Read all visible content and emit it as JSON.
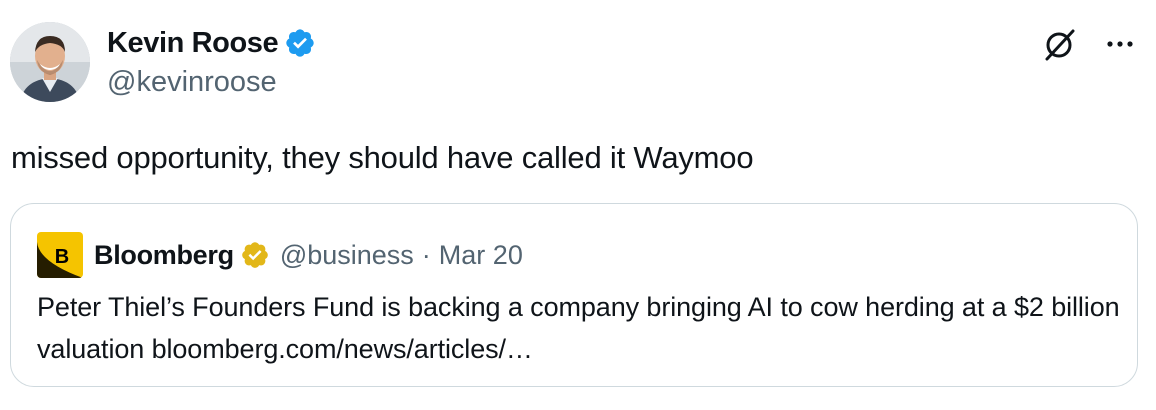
{
  "tweet": {
    "author": {
      "display_name": "Kevin Roose",
      "handle": "@kevinroose",
      "verified": true,
      "badge_color": "#1d9bf0"
    },
    "text": "missed opportunity, they should have called it Waymoo",
    "icons": {
      "grok": "grok-icon",
      "more": "more-options-icon"
    }
  },
  "quote": {
    "logo_letter": "B",
    "logo_color": "#f5c400",
    "display_name": "Bloomberg",
    "badge_color": "#e2b719",
    "handle": "@business",
    "separator": "·",
    "date": "Mar 20",
    "text": "Peter Thiel’s Founders Fund is backing a company bringing AI to cow herding at a $2 billion valuation bloomberg.com/news/articles/…"
  }
}
